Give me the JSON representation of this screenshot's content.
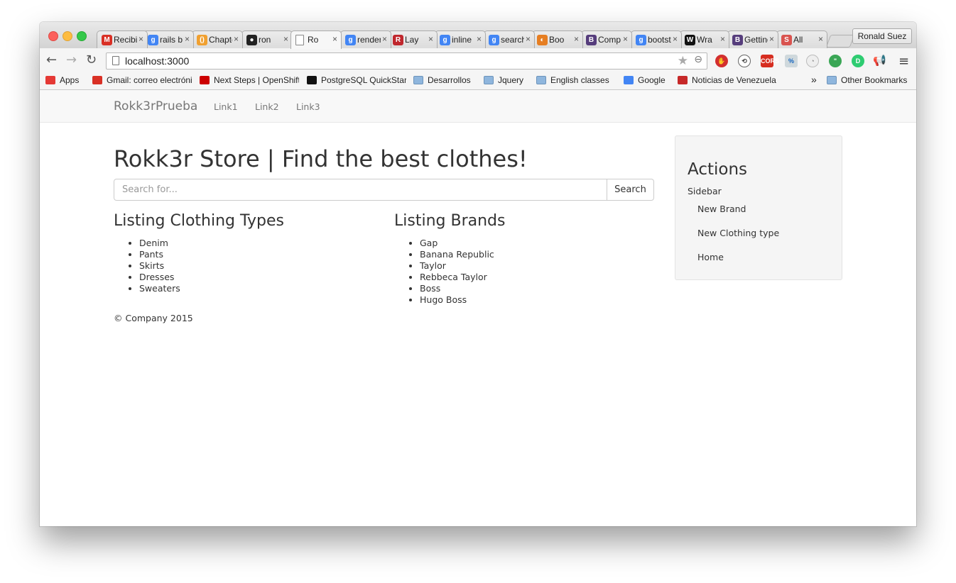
{
  "browser": {
    "tabs": [
      {
        "title": "Recibi",
        "favicon": "gmail-icon",
        "fav_text": "M",
        "fav_color": "#d93025"
      },
      {
        "title": "rails b",
        "favicon": "google-icon",
        "fav_text": "g",
        "fav_color": "#4285f4"
      },
      {
        "title": "Chapte",
        "favicon": "chapter-icon",
        "fav_text": "()",
        "fav_color": "#f0a030"
      },
      {
        "title": "ron",
        "favicon": "github-icon",
        "fav_text": "●",
        "fav_color": "#222222"
      },
      {
        "title": "Ro",
        "favicon": "page-icon",
        "fav_text": "",
        "fav_color": "#ffffff",
        "active": true
      },
      {
        "title": "render",
        "favicon": "google-icon",
        "fav_text": "g",
        "fav_color": "#4285f4"
      },
      {
        "title": "Lay",
        "favicon": "rails-icon",
        "fav_text": "R",
        "fav_color": "#c0272d"
      },
      {
        "title": "inline",
        "favicon": "google-icon",
        "fav_text": "g",
        "fav_color": "#4285f4"
      },
      {
        "title": "search",
        "favicon": "google-icon",
        "fav_text": "g",
        "fav_color": "#4285f4"
      },
      {
        "title": "Boo",
        "favicon": "boo-icon",
        "fav_text": "◐",
        "fav_color": "#e67e22"
      },
      {
        "title": "Comp",
        "favicon": "bootstrap-icon",
        "fav_text": "B",
        "fav_color": "#563d7c"
      },
      {
        "title": "bootst",
        "favicon": "google-icon",
        "fav_text": "g",
        "fav_color": "#4285f4"
      },
      {
        "title": "Wra",
        "favicon": "w-icon",
        "fav_text": "W",
        "fav_color": "#111111"
      },
      {
        "title": "Getting",
        "favicon": "bootstrap-icon",
        "fav_text": "B",
        "fav_color": "#563d7c"
      },
      {
        "title": "All",
        "favicon": "s-icon",
        "fav_text": "S",
        "fav_color": "#d9534f"
      }
    ],
    "profile": "Ronald Suez",
    "url": "localhost:3000",
    "bookmarks": [
      {
        "label": "Apps",
        "icon": "apps-grid-icon"
      },
      {
        "label": "Gmail: correo electrónico",
        "icon": "gmail-icon"
      },
      {
        "label": "Next Steps | OpenShift",
        "icon": "openshift-icon"
      },
      {
        "label": "PostgreSQL QuickStart",
        "icon": "intellij-icon"
      },
      {
        "label": "Desarrollos",
        "icon": "folder-icon"
      },
      {
        "label": "Jquery",
        "icon": "folder-icon"
      },
      {
        "label": "English classes",
        "icon": "folder-icon"
      },
      {
        "label": "Google",
        "icon": "google-icon"
      },
      {
        "label": "Noticias de Venezuela",
        "icon": "news-icon"
      }
    ],
    "bookmarks_overflow": "»",
    "other_bookmarks": "Other Bookmarks"
  },
  "navbar": {
    "brand": "Rokk3rPrueba",
    "links": [
      "Link1",
      "Link2",
      "Link3"
    ]
  },
  "main": {
    "heading": "Rokk3r Store | Find the best clothes!",
    "search": {
      "placeholder": "Search for...",
      "value": "",
      "button": "Search"
    },
    "clothing": {
      "title": "Listing Clothing Types",
      "items": [
        "Denim",
        "Pants",
        "Skirts",
        "Dresses",
        "Sweaters"
      ]
    },
    "brands": {
      "title": "Listing Brands",
      "items": [
        "Gap",
        "Banana Republic",
        "Taylor",
        "Rebbeca Taylor",
        "Boss",
        "Hugo Boss"
      ]
    },
    "footer": "© Company 2015"
  },
  "sidebar": {
    "title": "Actions",
    "subtitle": "Sidebar",
    "links": [
      "New Brand",
      "New Clothing type",
      "Home"
    ]
  }
}
